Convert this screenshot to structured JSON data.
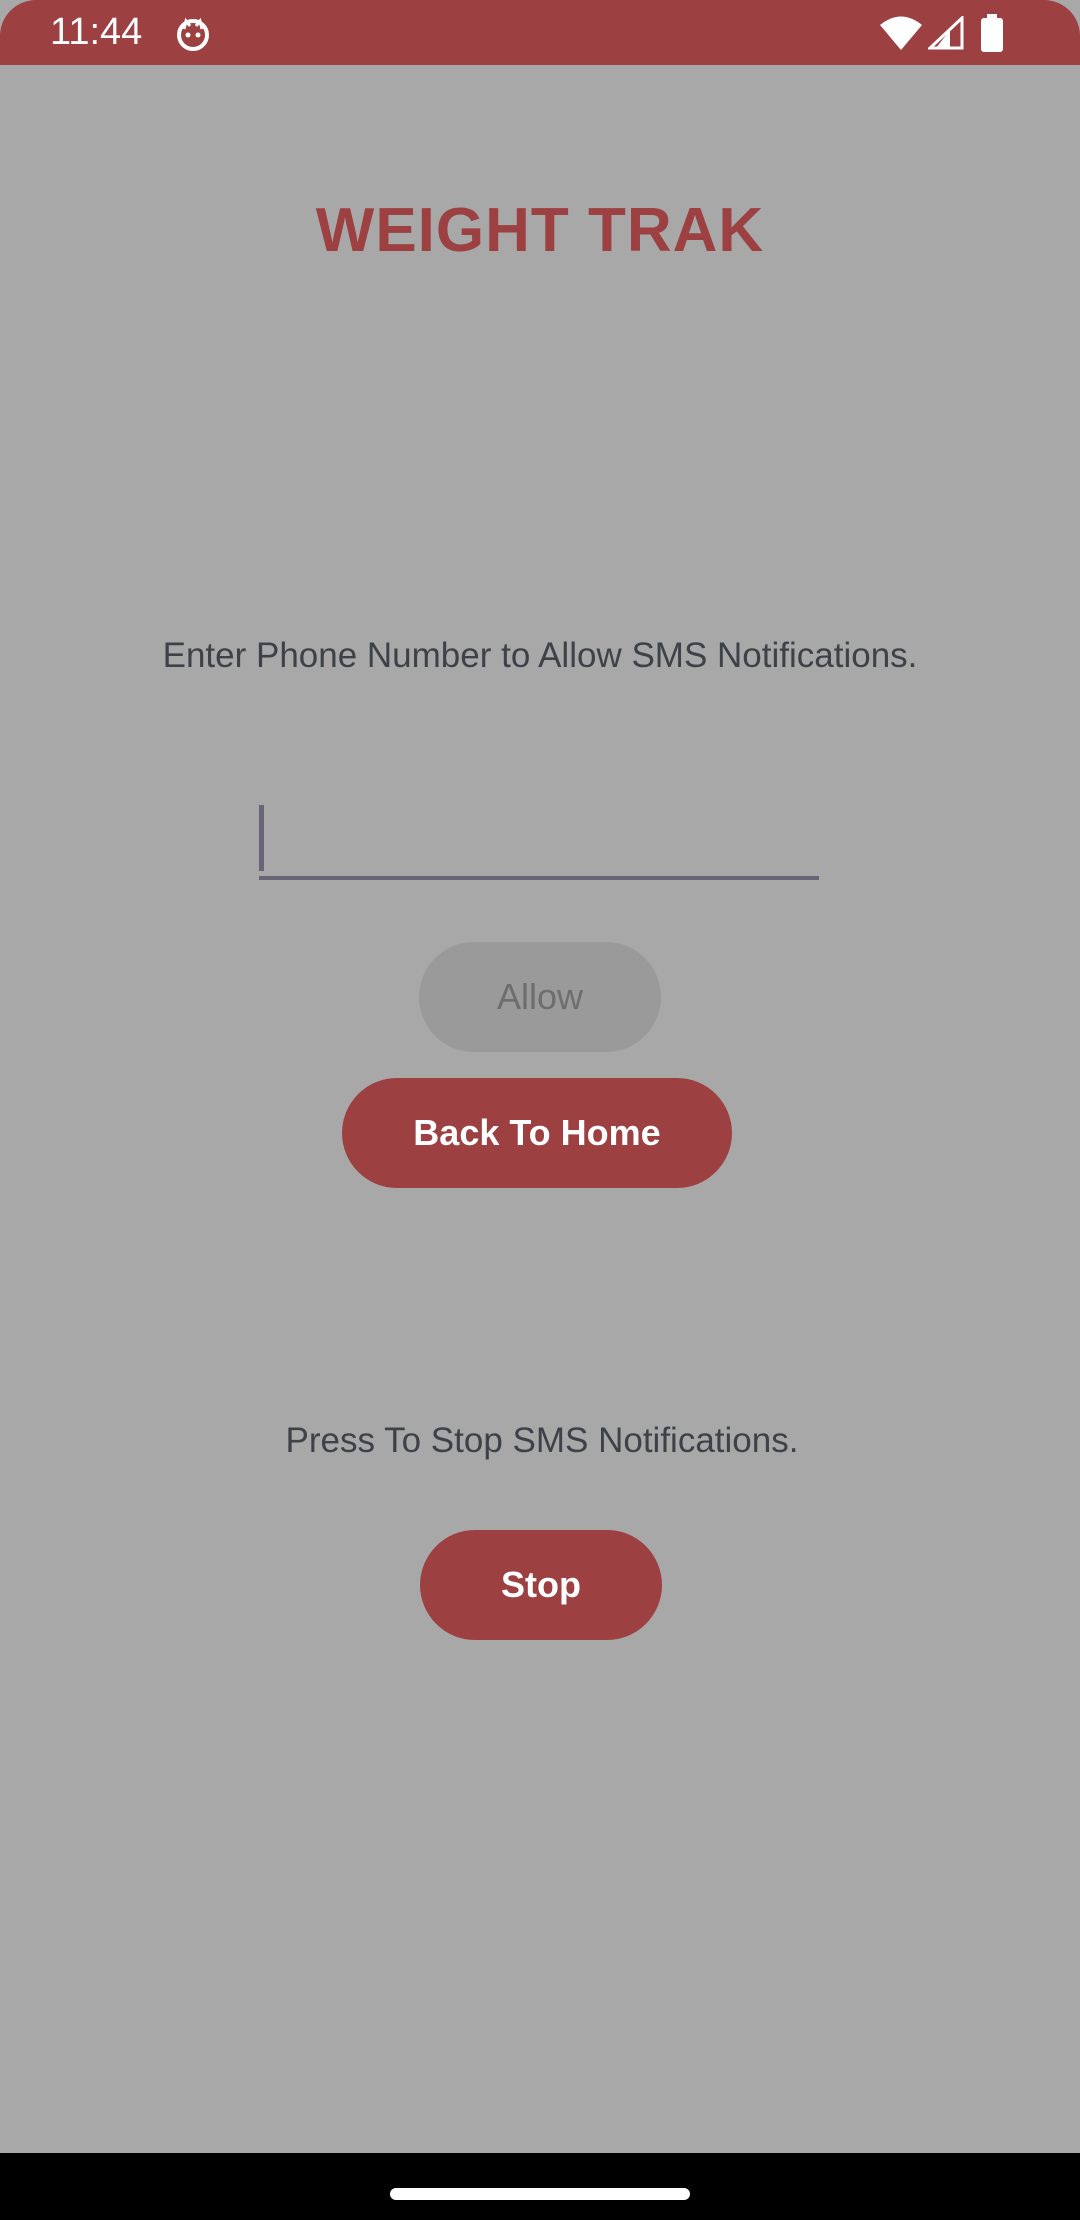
{
  "status_bar": {
    "time": "11:44",
    "icons": [
      "app-notification-icon",
      "wifi-icon",
      "signal-icon",
      "battery-icon"
    ]
  },
  "screen": {
    "title": "WEIGHT TRAK",
    "phone_prompt": "Enter Phone Number to Allow SMS Notifications.",
    "phone_input": {
      "value": "",
      "placeholder": ""
    },
    "allow_label": "Allow",
    "back_home_label": "Back To Home",
    "stop_prompt": "Press To Stop SMS Notifications.",
    "stop_label": "Stop"
  },
  "colors": {
    "accent": "#9c4042",
    "background": "#a8a8a8",
    "disabled_button": "#9a9a9a",
    "text": "#3e4248"
  }
}
